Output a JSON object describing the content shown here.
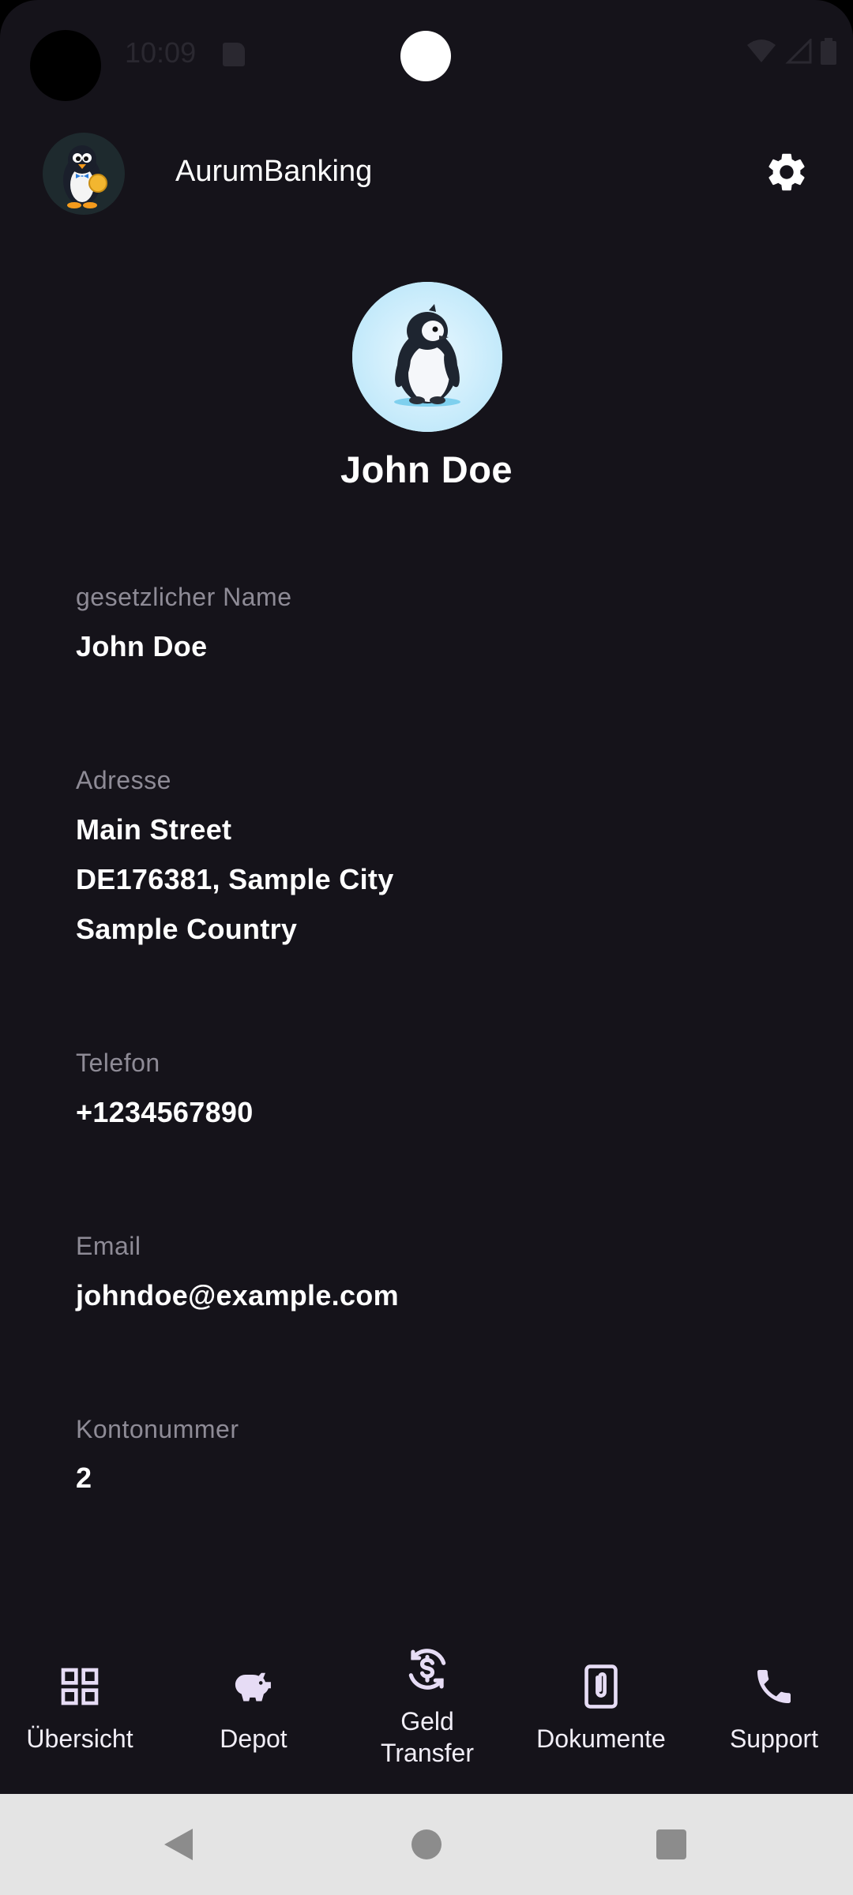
{
  "status_bar": {
    "time": "10:09"
  },
  "app_bar": {
    "title": "AurumBanking"
  },
  "profile": {
    "name": "John Doe"
  },
  "fields": {
    "legal_name": {
      "label": "gesetzlicher Name",
      "value": "John Doe"
    },
    "address": {
      "label": "Adresse",
      "line1": "Main Street",
      "line2": "DE176381, Sample City",
      "line3": "Sample Country"
    },
    "phone": {
      "label": "Telefon",
      "value": "+1234567890"
    },
    "email": {
      "label": "Email",
      "value": "johndoe@example.com"
    },
    "account_number": {
      "label": "Kontonummer",
      "value": "2"
    }
  },
  "bottom_nav": {
    "items": [
      {
        "label": "Übersicht",
        "icon": "grid-icon"
      },
      {
        "label": "Depot",
        "icon": "piggy-bank-icon"
      },
      {
        "label": "Geld\nTransfer",
        "icon": "currency-exchange-icon"
      },
      {
        "label": "Dokumente",
        "icon": "attachment-document-icon"
      },
      {
        "label": "Support",
        "icon": "phone-icon"
      }
    ]
  },
  "colors": {
    "background": "#15131a",
    "label": "#8e8b96",
    "text": "#ffffff",
    "nav_icon": "#e6dcf5",
    "system_nav": "#e4e4e4"
  }
}
